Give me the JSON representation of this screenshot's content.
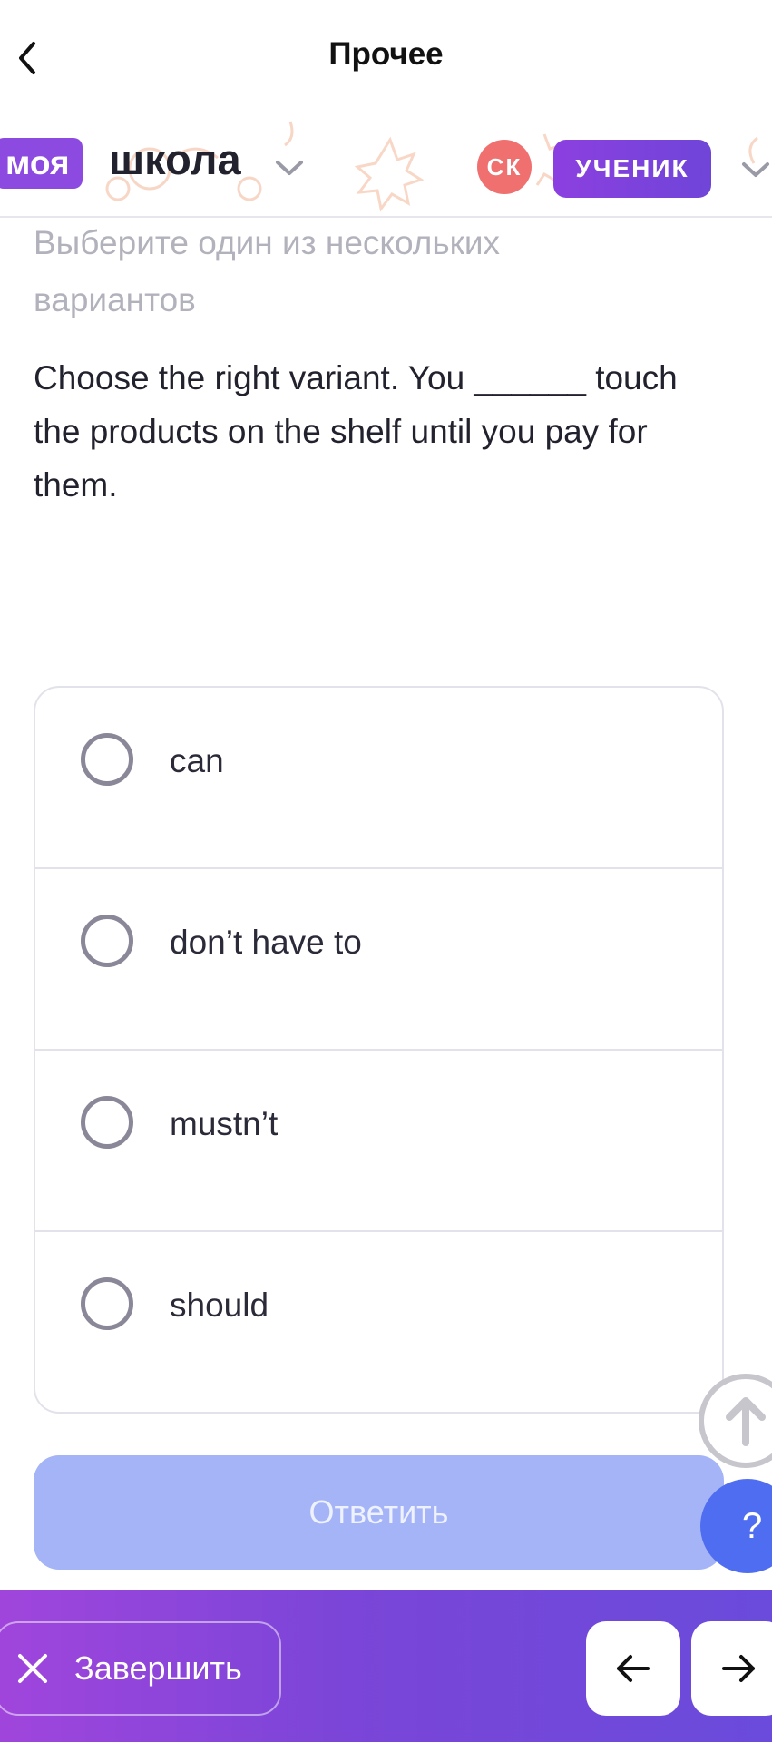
{
  "header": {
    "title": "Прочее"
  },
  "brand": {
    "chip": "моя",
    "word": "школа"
  },
  "user": {
    "initials": "СК",
    "role": "УЧЕНИК"
  },
  "question": {
    "instruction": "Выберите один из нескольких вариантов",
    "text": "Choose the right variant. You ______ touch the products on the shelf until you pay for them."
  },
  "options": [
    "can",
    "don’t have to",
    "mustn’t",
    "should"
  ],
  "actions": {
    "answer": "Ответить",
    "help": "?",
    "finish": "Завершить"
  },
  "colors": {
    "accent": "#8d4ae0",
    "answer_button": "#a4b4f6",
    "help_button": "#4f6df0",
    "avatar": "#f07070"
  },
  "icons": {
    "back": "chevron-left-icon",
    "scroll_up": "arrow-up-icon",
    "close": "close-icon",
    "prev": "arrow-left-icon",
    "next": "arrow-right-icon"
  }
}
